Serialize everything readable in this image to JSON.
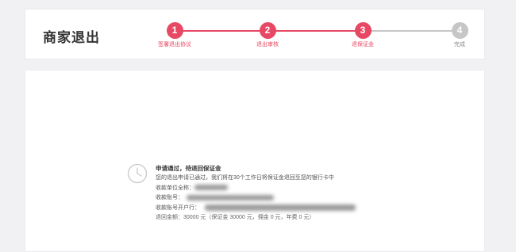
{
  "header": {
    "title": "商家退出"
  },
  "steps": [
    {
      "number": "1",
      "label": "签署退出协议",
      "state": "done"
    },
    {
      "number": "2",
      "label": "退出审核",
      "state": "done"
    },
    {
      "number": "3",
      "label": "退保证金",
      "state": "active"
    },
    {
      "number": "4",
      "label": "完成",
      "state": "pending"
    }
  ],
  "colors": {
    "accent": "#e74863",
    "pending": "#c6c6c6"
  },
  "icons": {
    "status": "clock-icon"
  },
  "status": {
    "title": "申请通过，待退回保证金",
    "description": "您的退出申请已通过，我们将在30个工作日将保证金退回至您的银行卡中",
    "account_name_label": "收款单位全称：",
    "account_number_label": "收款账号：",
    "bank_label": "收款账号开户行：",
    "amount_line": "退回金额：30000 元（保证金 30000 元，佣金 0 元，年费 0 元）"
  }
}
